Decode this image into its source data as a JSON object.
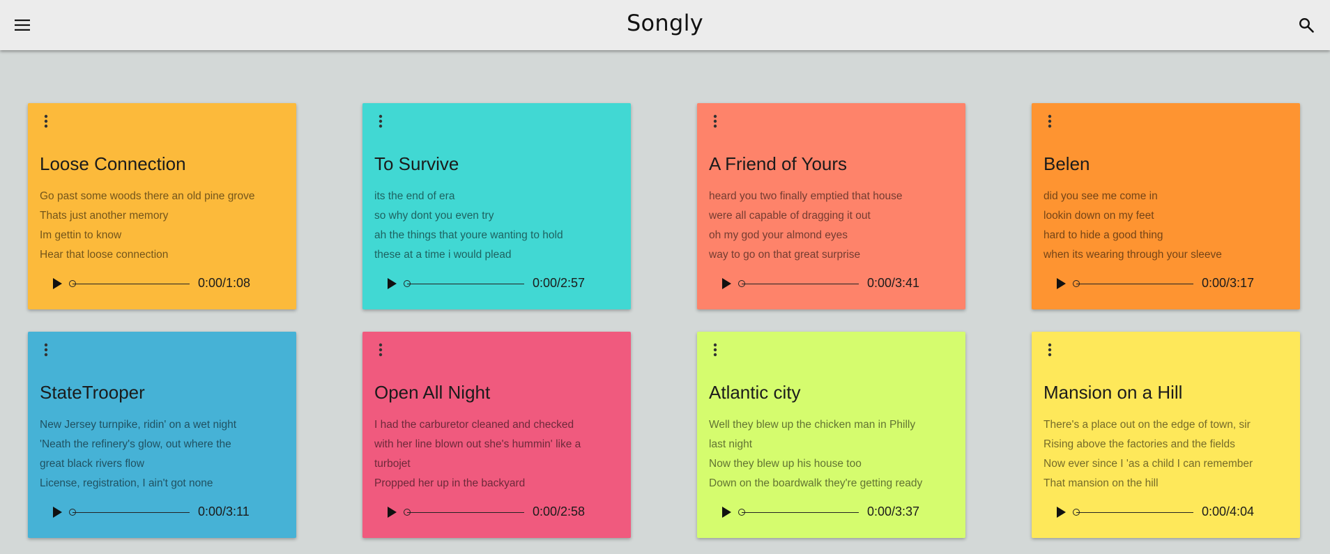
{
  "app": {
    "title": "Songly",
    "menu_icon": "hamburger-menu-icon",
    "search_icon": "search-icon"
  },
  "songs": [
    {
      "title": "Loose Connection",
      "color": "#fcba3b",
      "lyrics": [
        "Go past some woods there an old pine grove",
        "Thats just another memory",
        "Im gettin to know",
        "Hear that loose connection"
      ],
      "time": "0:00/1:08"
    },
    {
      "title": "To Survive",
      "color": "#41d8d3",
      "lyrics": [
        "its the end of era",
        "so why dont you even try",
        "ah the things that youre wanting to hold",
        "these at a time i would plead"
      ],
      "time": "0:00/2:57"
    },
    {
      "title": "A Friend of Yours",
      "color": "#fe836a",
      "lyrics": [
        "heard you two finally emptied that house",
        "were all capable of dragging it out",
        "oh my god your almond eyes",
        "way to go on that great surprise"
      ],
      "time": "0:00/3:41"
    },
    {
      "title": "Belen",
      "color": "#fe9431",
      "lyrics": [
        "did you see me come in",
        "lookin down on my feet",
        "hard to hide a good thing",
        "when its wearing through your sleeve"
      ],
      "time": "0:00/3:17"
    },
    {
      "title": "StateTrooper",
      "color": "#46b2d6",
      "lyrics": [
        "New Jersey turnpike, ridin' on a wet night",
        "'Neath the refinery's glow, out where the",
        "great black rivers flow",
        "License, registration, I ain't got none"
      ],
      "time": "0:00/3:11"
    },
    {
      "title": "Open All Night",
      "color": "#f05a7e",
      "lyrics": [
        "I had the carburetor cleaned and checked",
        "with her line blown out she's hummin' like a",
        "turbojet",
        "Propped her up in the backyard"
      ],
      "time": "0:00/2:58"
    },
    {
      "title": "Atlantic city",
      "color": "#d5fc6e",
      "lyrics": [
        "Well they blew up the chicken man in Philly",
        "last night",
        "Now they blew up his house too",
        "Down on the boardwalk they're getting ready"
      ],
      "time": "0:00/3:37"
    },
    {
      "title": "Mansion on a Hill",
      "color": "#fee85a",
      "lyrics": [
        "There's a place out on the edge of town, sir",
        "Rising above the factories and the fields",
        "Now ever since I 'as a child I can remember",
        "That mansion on the hill"
      ],
      "time": "0:00/4:04"
    }
  ],
  "player": {
    "play_icon": "play-icon",
    "progress": 0
  },
  "card": {
    "menu_icon": "more-vert-icon"
  }
}
